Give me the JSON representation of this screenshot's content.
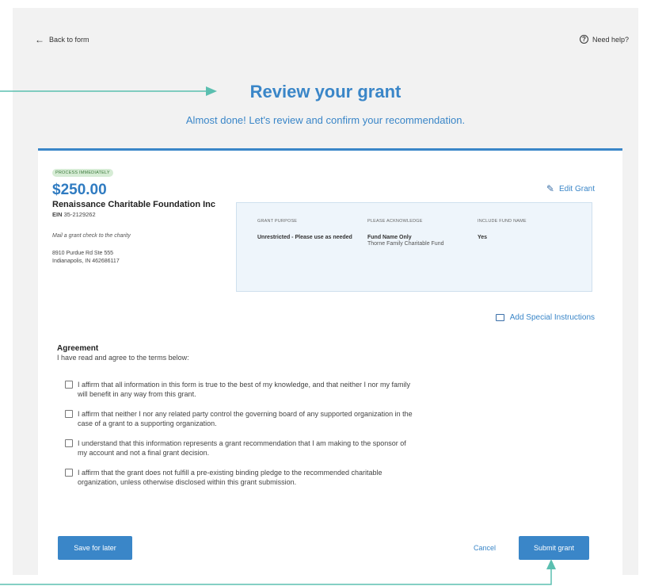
{
  "nav": {
    "back_label": "Back to form",
    "help_label": "Need help?"
  },
  "header": {
    "title": "Review your grant",
    "subtitle": "Almost done! Let's review and confirm your recommendation."
  },
  "grant": {
    "badge": "PROCESS IMMEDIATELY",
    "amount": "$250.00",
    "org_name": "Renaissance Charitable Foundation Inc",
    "ein_label": "EIN",
    "ein_value": "35-2129262",
    "mail_note": "Mail a grant check to the charity",
    "address_line1": "8910 Purdue Rd Ste 555",
    "address_line2": "Indianapolis, IN 462686117",
    "edit_label": "Edit Grant"
  },
  "details": {
    "purpose_label": "GRANT PURPOSE",
    "purpose_value": "Unrestricted - Please use as needed",
    "acknowledge_label": "PLEASE ACKNOWLEDGE",
    "acknowledge_value": "Fund Name Only",
    "acknowledge_sub": "Thorne Family Charitable Fund",
    "fundname_label": "INCLUDE FUND NAME",
    "fundname_value": "Yes"
  },
  "special_instructions_label": "Add Special Instructions",
  "agreement": {
    "title": "Agreement",
    "subtitle": "I have read and agree to the terms below:",
    "items": [
      "I affirm that all information in this form is true to the best of my knowledge, and that neither I nor my family will benefit in any way from this grant.",
      "I affirm that neither I nor any related party control the governing board of any supported organization in the case of a grant to a supporting organization.",
      "I understand that this information represents a grant recommendation that I am making to the sponsor of my account and not a final grant decision.",
      "I affirm that the grant does not fulfill a pre-existing binding pledge to the recommended charitable organization, unless otherwise disclosed within this grant submission."
    ]
  },
  "actions": {
    "save_label": "Save for later",
    "cancel_label": "Cancel",
    "submit_label": "Submit grant"
  },
  "colors": {
    "accent": "#3a86c8",
    "annotation": "#5bbfb0",
    "badge_bg": "#d6ecd5",
    "page_bg": "#f2f2f2"
  }
}
